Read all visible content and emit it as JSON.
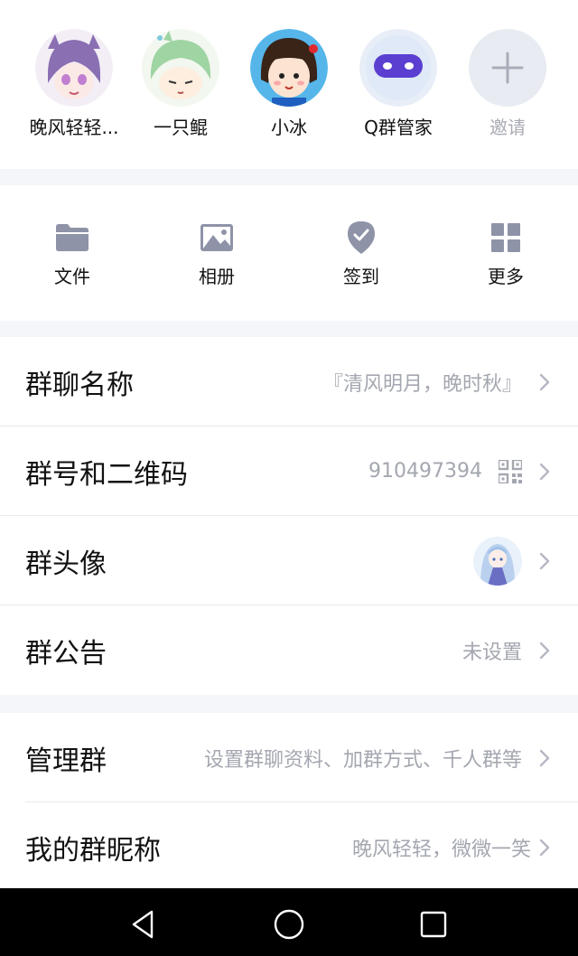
{
  "members": [
    {
      "name": "晚风轻轻...",
      "avatar": "avatar-purple-hair"
    },
    {
      "name": "一只鲲",
      "avatar": "avatar-green-hair"
    },
    {
      "name": "小冰",
      "avatar": "avatar-xiaobing"
    },
    {
      "name": "Q群管家",
      "avatar": "avatar-robot"
    },
    {
      "name": "邀请",
      "avatar": "plus-icon"
    }
  ],
  "tools": [
    {
      "label": "文件",
      "icon": "folder-icon"
    },
    {
      "label": "相册",
      "icon": "image-icon"
    },
    {
      "label": "签到",
      "icon": "checkin-icon"
    },
    {
      "label": "更多",
      "icon": "grid-icon"
    }
  ],
  "settings": {
    "group_name": {
      "title": "群聊名称",
      "value": "『清风明月，晚时秋』"
    },
    "group_number": {
      "title": "群号和二维码",
      "value": "910497394"
    },
    "group_avatar": {
      "title": "群头像"
    },
    "announcement": {
      "title": "群公告",
      "value": "未设置"
    },
    "manage": {
      "title": "管理群",
      "value": "设置群聊资料、加群方式、千人群等"
    },
    "nickname": {
      "title": "我的群昵称",
      "value": "晚风轻轻，微微一笑"
    }
  },
  "colors": {
    "accent_icon": "#8f93a8",
    "chevron": "#b5b8c2",
    "muted_text": "#a4a7b0"
  }
}
